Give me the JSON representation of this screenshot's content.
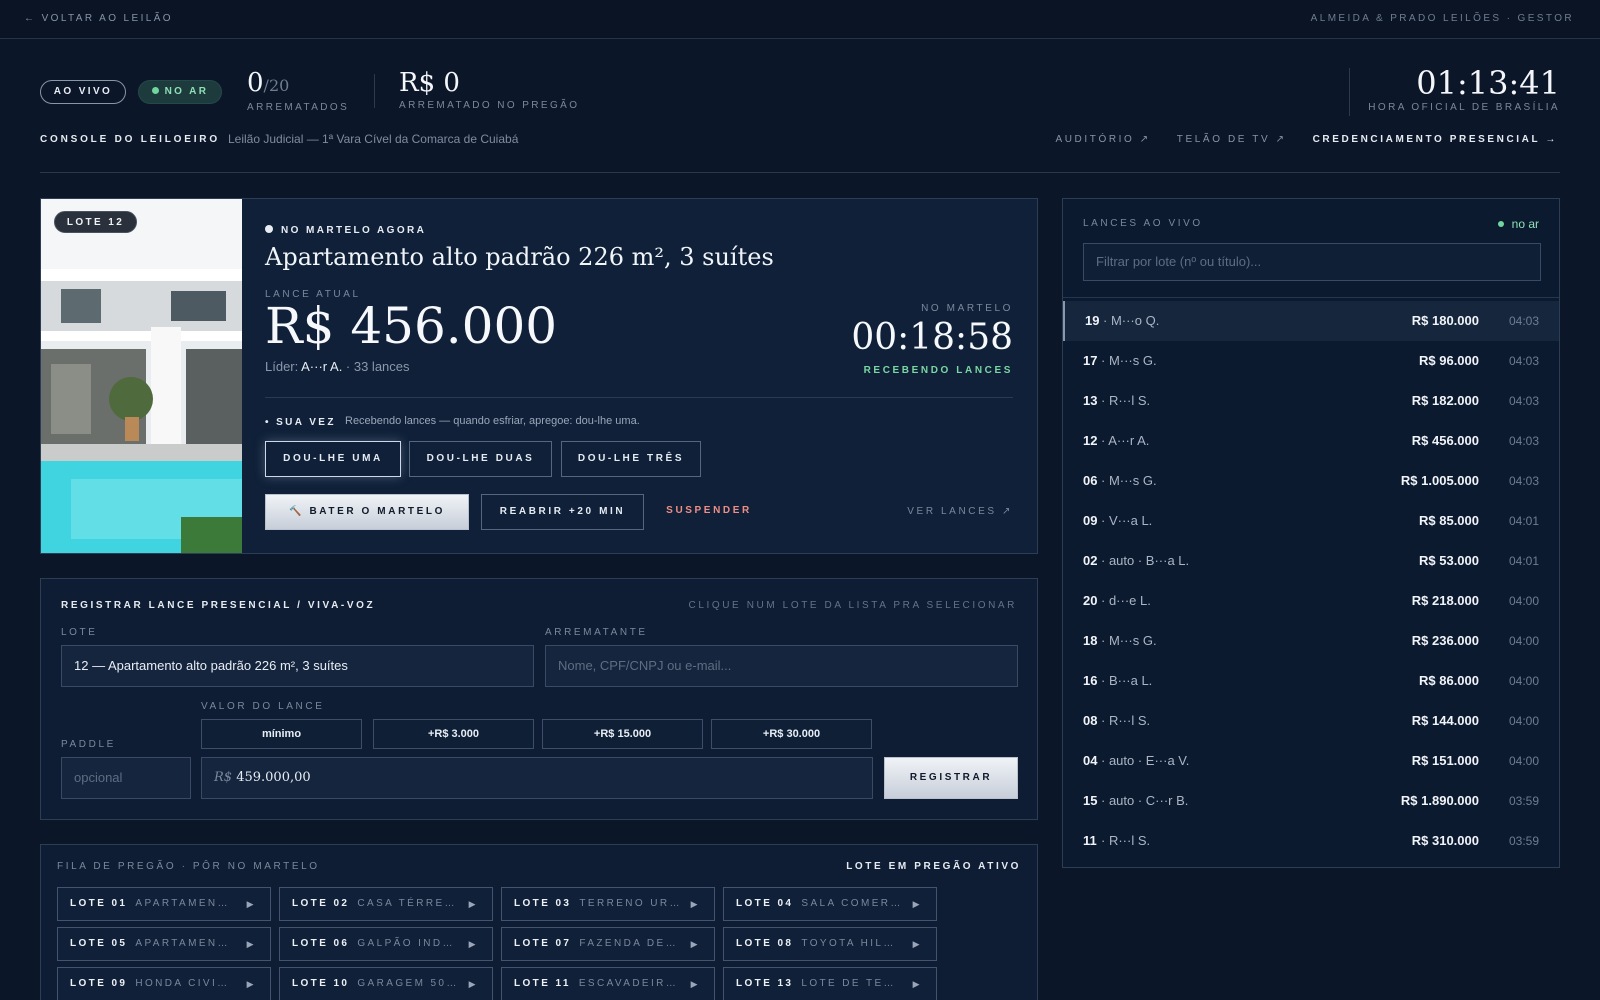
{
  "topbar": {
    "back": "← VOLTAR AO LEILÃO",
    "brand": "ALMEIDA & PRADO LEILÕES · GESTOR"
  },
  "status": {
    "live": "AO VIVO",
    "air": "NO AR",
    "count": "0",
    "count_total": "/20",
    "count_label": "ARREMATADOS",
    "total": "R$ 0",
    "total_label": "ARREMATADO NO PREGÃO",
    "clock": "01:13:41",
    "clock_label": "HORA OFICIAL DE BRASÍLIA"
  },
  "header": {
    "console": "CONSOLE DO LEILOEIRO",
    "subtitle": "Leilão Judicial — 1ª Vara Cível da Comarca de Cuiabá",
    "links": [
      "AUDITÓRIO ↗",
      "TELÃO DE TV ↗",
      "CREDENCIAMENTO PRESENCIAL →"
    ]
  },
  "hero": {
    "badge": "LOTE 12",
    "on_now": "NO MARTELO AGORA",
    "title": "Apartamento alto padrão 226 m², 3 suítes",
    "lance_label": "LANCE ATUAL",
    "price": "R$ 456.000",
    "leader_prefix": "Líder: ",
    "leader": "A···r A.",
    "lances": " · 33 lances",
    "timer_label": "NO MARTELO",
    "timer": "00:18:58",
    "timer_status": "RECEBENDO LANCES",
    "sua_vez": "SUA VEZ",
    "sua_vez_text": "Recebendo lances — quando esfriar, apregoe: dou-lhe uma.",
    "calls": [
      "DOU-LHE UMA",
      "DOU-LHE DUAS",
      "DOU-LHE TRÊS"
    ],
    "hammer": "🔨 BATER O MARTELO",
    "reopen": "REABRIR +20 MIN",
    "suspend": "SUSPENDER",
    "ver": "VER LANCES ↗"
  },
  "register": {
    "title": "REGISTRAR LANCE PRESENCIAL / VIVA-VOZ",
    "hint": "CLIQUE NUM LOTE DA LISTA PRA SELECIONAR",
    "lote_label": "LOTE",
    "lote_value": "12 — Apartamento alto padrão 226 m², 3 suítes",
    "arr_label": "ARREMATANTE",
    "arr_placeholder": "Nome, CPF/CNPJ ou e-mail...",
    "valor_label": "VALOR DO LANCE",
    "chips": [
      "mínimo",
      "+R$ 3.000",
      "+R$ 15.000",
      "+R$ 30.000"
    ],
    "paddle_label": "PADDLE",
    "paddle_placeholder": "opcional",
    "currency": "R$",
    "amount": "459.000,00",
    "submit": "REGISTRAR"
  },
  "queue": {
    "title": "FILA DE PREGÃO · PÔR NO MARTELO",
    "active": "LOTE EM PREGÃO ATIVO",
    "items": [
      {
        "lot": "LOTE 01",
        "name": "APARTAMEN…"
      },
      {
        "lot": "LOTE 02",
        "name": "CASA TÉRRE…"
      },
      {
        "lot": "LOTE 03",
        "name": "TERRENO UR…"
      },
      {
        "lot": "LOTE 04",
        "name": "SALA COMER…"
      },
      {
        "lot": "LOTE 05",
        "name": "APARTAMEN…"
      },
      {
        "lot": "LOTE 06",
        "name": "GALPÃO IND…"
      },
      {
        "lot": "LOTE 07",
        "name": "FAZENDA DE…"
      },
      {
        "lot": "LOTE 08",
        "name": "TOYOTA HIL…"
      },
      {
        "lot": "LOTE 09",
        "name": "HONDA CIVI…"
      },
      {
        "lot": "LOTE 10",
        "name": "GARAGEM 50…"
      },
      {
        "lot": "LOTE 11",
        "name": "ESCAVADEIR…"
      },
      {
        "lot": "LOTE 13",
        "name": "LOTE DE TE…"
      }
    ]
  },
  "bids": {
    "title": "LANCES AO VIVO",
    "status": "no ar",
    "filter_placeholder": "Filtrar por lote (nº ou título)...",
    "rows": [
      {
        "lot": "19",
        "who": "· M···o Q.",
        "value": "R$ 180.000",
        "time": "04:03"
      },
      {
        "lot": "17",
        "who": "· M···s G.",
        "value": "R$ 96.000",
        "time": "04:03"
      },
      {
        "lot": "13",
        "who": "· R···l S.",
        "value": "R$ 182.000",
        "time": "04:03"
      },
      {
        "lot": "12",
        "who": "· A···r A.",
        "value": "R$ 456.000",
        "time": "04:03"
      },
      {
        "lot": "06",
        "who": "· M···s G.",
        "value": "R$ 1.005.000",
        "time": "04:03"
      },
      {
        "lot": "09",
        "who": "· V···a L.",
        "value": "R$ 85.000",
        "time": "04:01"
      },
      {
        "lot": "02",
        "who": "· auto · B···a L.",
        "value": "R$ 53.000",
        "time": "04:01"
      },
      {
        "lot": "20",
        "who": "· d···e L.",
        "value": "R$ 218.000",
        "time": "04:00"
      },
      {
        "lot": "18",
        "who": "· M···s G.",
        "value": "R$ 236.000",
        "time": "04:00"
      },
      {
        "lot": "16",
        "who": "· B···a L.",
        "value": "R$ 86.000",
        "time": "04:00"
      },
      {
        "lot": "08",
        "who": "· R···l S.",
        "value": "R$ 144.000",
        "time": "04:00"
      },
      {
        "lot": "04",
        "who": "· auto · E···a V.",
        "value": "R$ 151.000",
        "time": "04:00"
      },
      {
        "lot": "15",
        "who": "· auto · C···r B.",
        "value": "R$ 1.890.000",
        "time": "03:59"
      },
      {
        "lot": "11",
        "who": "· R···l S.",
        "value": "R$ 310.000",
        "time": "03:59"
      }
    ]
  }
}
